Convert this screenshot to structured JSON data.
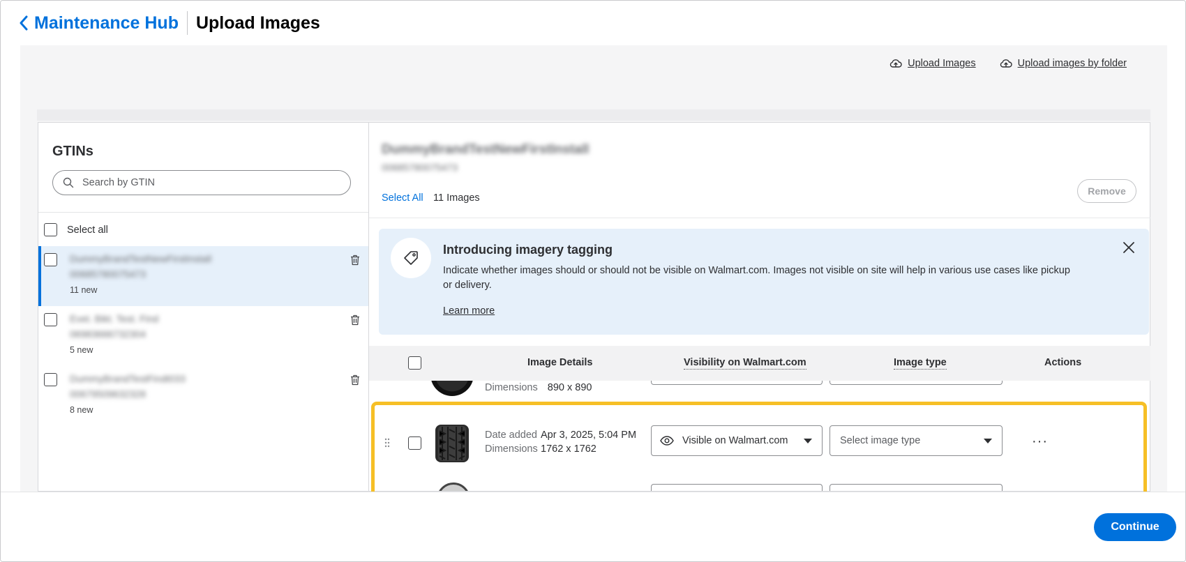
{
  "header": {
    "back_label": "Maintenance Hub",
    "title": "Upload Images"
  },
  "toolbar": {
    "upload_images": "Upload Images",
    "upload_by_folder": "Upload images by folder"
  },
  "left_panel": {
    "title": "GTINs",
    "search_placeholder": "Search by GTIN",
    "select_all": "Select all",
    "items": [
      {
        "name": "DummyBrandTestNewFirstInstall",
        "gtin": "00685780075473",
        "count": "11 new",
        "selected": true
      },
      {
        "name": "Evet. Bikt. Test. Find",
        "gtin": "06983666732304",
        "count": "5 new",
        "selected": false
      },
      {
        "name": "DummyBrandTestFindt033",
        "gtin": "00679509632328",
        "count": "8 new",
        "selected": false
      }
    ]
  },
  "right_panel": {
    "product_name": "DummyBrandTestNewFirstInstall",
    "product_gtin": "00685780075473",
    "select_all": "Select All",
    "image_count": "11 Images",
    "remove_label": "Remove"
  },
  "banner": {
    "title": "Introducing imagery tagging",
    "text": "Indicate whether images should or should not be visible on Walmart.com. Images not visible on site will help in various use cases like pickup or delivery.",
    "learn_more": "Learn more"
  },
  "table": {
    "columns": {
      "details": "Image Details",
      "visibility": "Visibility on Walmart.com",
      "type": "Image type",
      "actions": "Actions"
    },
    "partial_top": {
      "dimensions_label": "Dimensions",
      "dimensions": "890 x 890"
    },
    "row": {
      "date_label": "Date added",
      "date": "Apr 3, 2025, 5:04 PM",
      "dimensions_label": "Dimensions",
      "dimensions": "1762 x 1762",
      "visibility": "Visible on Walmart.com",
      "type_placeholder": "Select image type",
      "more": "···"
    }
  },
  "footer": {
    "continue_label": "Continue"
  },
  "colors": {
    "accent": "#0071dc",
    "banner_bg": "#e6f0fa",
    "highlight": "#f6bf26",
    "work_bg": "#f5f5f6"
  }
}
